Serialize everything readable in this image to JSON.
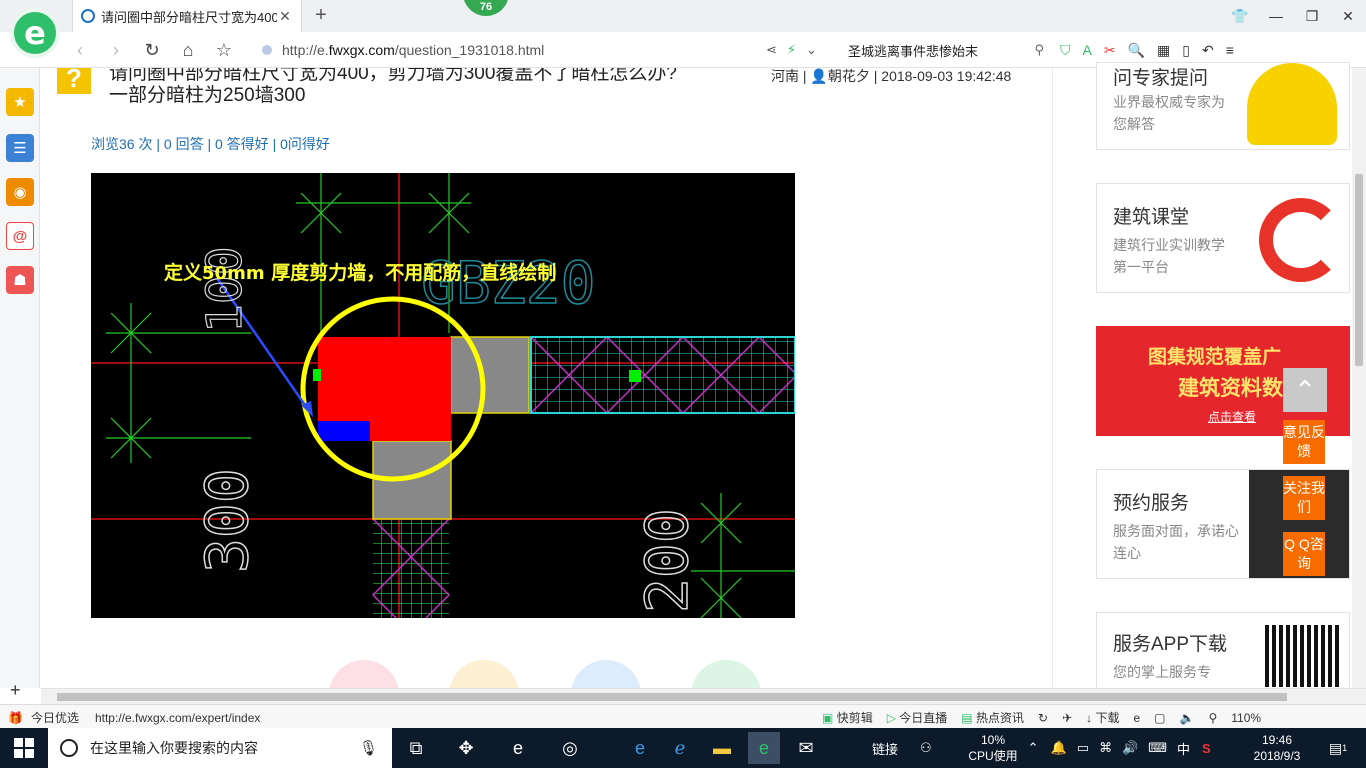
{
  "browser": {
    "tab_title": "请问圈中部分暗柱尺寸宽为400...",
    "tab_badge": "76",
    "url_scheme": "http://e.",
    "url_domain": "fwxgx.com",
    "url_path": "/question_1931018.html",
    "search_text": "圣城逃离事件悲惨始末",
    "zoom": "110%"
  },
  "question": {
    "icon_glyph": "?",
    "title_line1": "请问圈中部分暗柱尺寸宽为400，剪力墙为300覆盖不了暗柱怎么办?",
    "title_line2": "一部分暗柱为250墙300",
    "region": "河南",
    "separator": "|",
    "author": "朝花夕",
    "date": "2018-09-03 19:42:48",
    "views": "浏览36 次",
    "answers": "0 回答",
    "good_answers": "0 答得好",
    "good_questions": "0问得好"
  },
  "cad": {
    "annotation_prefix": "定义",
    "annotation_bold": "50mm",
    "annotation_suffix": " 厚度剪力墙，不用配筋，直线绘制",
    "label_gbz": "GBZ20",
    "label_100": "100",
    "label_300": "300",
    "label_200": "200"
  },
  "sidebar_right": {
    "cards": [
      {
        "title": "问专家提问",
        "desc": "业界最权威专家为您解答"
      },
      {
        "title": "建筑课堂",
        "desc": "建筑行业实训教学第一平台"
      },
      {
        "banner_line1": "图集规范覆盖广",
        "banner_line2": "建筑资料数",
        "banner_link": "点击查看"
      },
      {
        "title": "预约服务",
        "desc": "服务面对面，承诺心连心"
      },
      {
        "title": "服务APP下载",
        "desc": "您的掌上服务专"
      }
    ],
    "float_buttons": [
      "意见反馈",
      "关注我们",
      "Q Q咨询"
    ]
  },
  "statusbar": {
    "left_label": "今日优选",
    "hover_url": "http://e.fwxgx.com/expert/index",
    "items": [
      "快剪辑",
      "今日直播",
      "热点资讯",
      "下载"
    ],
    "zoom": "110%"
  },
  "taskbar": {
    "search_placeholder": "在这里输入你要搜索的内容",
    "tray_link": "链接",
    "cpu_percent": "10%",
    "cpu_label": "CPU使用",
    "ime": "中",
    "time": "19:46",
    "date": "2018/9/3",
    "notification_count": "1"
  },
  "colors": {
    "cad_red": "#ff0000",
    "cad_yellow": "#ffff00",
    "link_blue": "#1f6fb5",
    "float_orange": "#f76c00",
    "browser_green": "#2fbf6a"
  }
}
